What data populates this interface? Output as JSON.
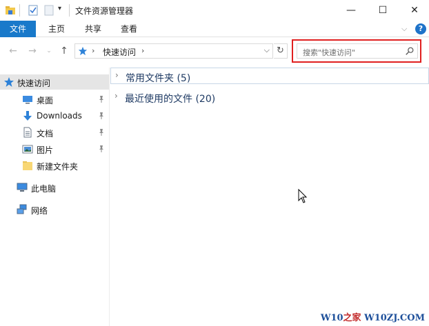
{
  "window": {
    "title": "文件资源管理器",
    "controls": {
      "minimize": "—",
      "maximize": "☐",
      "close": "✕"
    }
  },
  "ribbon": {
    "tabs": [
      {
        "label": "文件",
        "active": true
      },
      {
        "label": "主页"
      },
      {
        "label": "共享"
      },
      {
        "label": "查看"
      }
    ],
    "help": "?"
  },
  "address_bar": {
    "path": [
      "快速访问"
    ],
    "separator": "›",
    "dropdown": "⌵",
    "refresh": "↻"
  },
  "search": {
    "placeholder": "搜索\"快速访问\""
  },
  "nav_pane": {
    "items": [
      {
        "label": "快速访问",
        "icon": "star-icon",
        "selected": true
      },
      {
        "label": "桌面",
        "icon": "desktop-icon",
        "pinned": true
      },
      {
        "label": "Downloads",
        "icon": "download-arrow-icon",
        "pinned": true
      },
      {
        "label": "文档",
        "icon": "document-icon",
        "pinned": true
      },
      {
        "label": "图片",
        "icon": "picture-icon",
        "pinned": true
      },
      {
        "label": "新建文件夹",
        "icon": "folder-icon"
      },
      {
        "label": "此电脑",
        "icon": "computer-icon"
      },
      {
        "label": "网络",
        "icon": "network-icon"
      }
    ]
  },
  "content": {
    "groups": [
      {
        "label": "常用文件夹 (5)"
      },
      {
        "label": "最近使用的文件 (20)"
      }
    ]
  },
  "watermark": {
    "prefix": "W10",
    "middle": "之家",
    "suffix": " W10ZJ.COM"
  },
  "colors": {
    "accent": "#1979ca",
    "highlight": "#e01f1f",
    "selected_bg": "#e5e5e5"
  }
}
